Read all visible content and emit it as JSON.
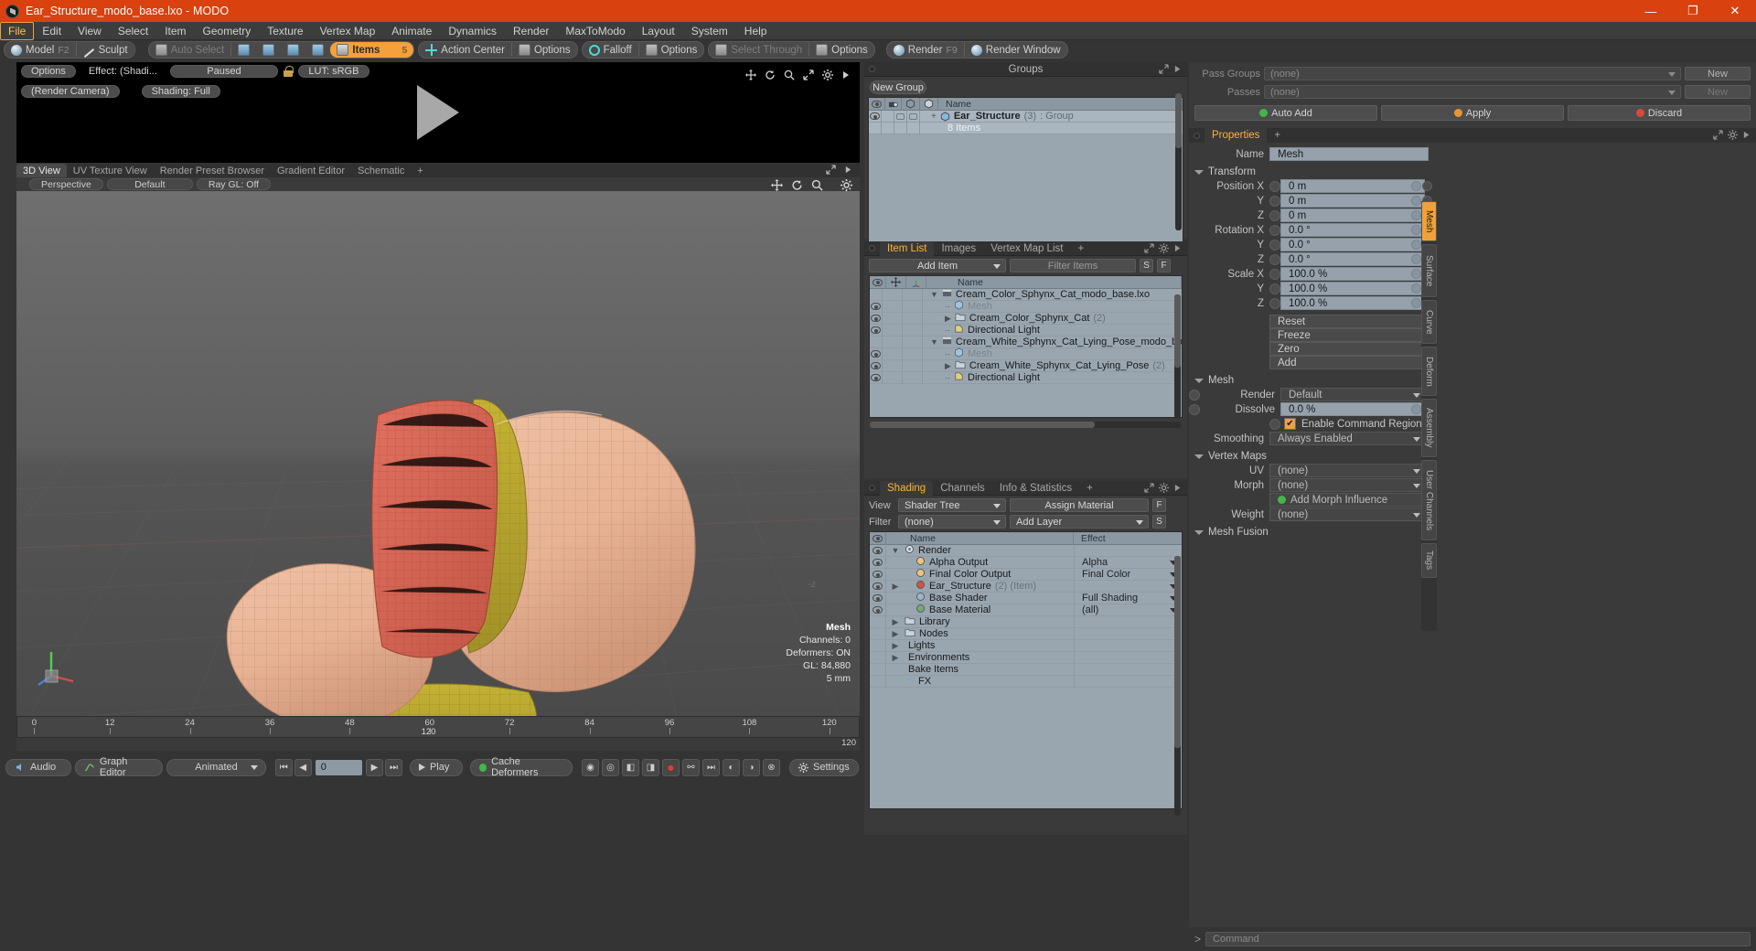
{
  "window": {
    "title": "Ear_Structure_modo_base.lxo - MODO",
    "minimize": "—",
    "maximize": "❐",
    "close": "✕"
  },
  "menubar": {
    "items": [
      "File",
      "Edit",
      "View",
      "Select",
      "Item",
      "Geometry",
      "Texture",
      "Vertex Map",
      "Animate",
      "Dynamics",
      "Render",
      "MaxToModo",
      "Layout",
      "System",
      "Help"
    ],
    "active": "File"
  },
  "toolbar": {
    "mode_group": [
      {
        "label": "Model",
        "shortcut": "F2"
      },
      {
        "label": "Sculpt",
        "shortcut": ""
      }
    ],
    "select_group": [
      {
        "label": "Auto Select",
        "shortcut": ""
      },
      {
        "label": "Items",
        "shortcut": "5",
        "active": true
      }
    ],
    "action_center": "Action Center",
    "options_1": "Options",
    "falloff": "Falloff",
    "options_2": "Options",
    "select_through": "Select Through",
    "options_3": "Options",
    "render": "Render",
    "render_key": "F9",
    "render_window": "Render Window"
  },
  "render_preview": {
    "options": "Options",
    "effect": "Effect: (Shadi...",
    "paused": "Paused",
    "lut": "LUT: sRGB",
    "camera": "(Render Camera)",
    "shading": "Shading: Full",
    "icons": [
      "move-icon",
      "refresh-icon",
      "zoom-icon",
      "fit-icon",
      "gear-icon",
      "play-arrow-icon"
    ]
  },
  "viewport": {
    "tabs": [
      "3D View",
      "UV Texture View",
      "Render Preset Browser",
      "Gradient Editor",
      "Schematic"
    ],
    "selected_tab": "3D View",
    "add_tab": "+",
    "sub_controls": [
      "Perspective",
      "Default",
      "Ray GL: Off"
    ],
    "icons": [
      "move-icon",
      "rotate-icon",
      "zoom-icon",
      "gear-icon"
    ],
    "stats": {
      "title": "Mesh",
      "channels_label": "Channels:",
      "channels_value": "0",
      "deformers_label": "Deformers:",
      "deformers_value": "ON",
      "gl_label": "GL:",
      "gl_value": "84,880",
      "scale": "5 mm"
    },
    "axis_label_z": "-z"
  },
  "timeline": {
    "ticks": [
      "0",
      "12",
      "24",
      "36",
      "48",
      "60",
      "72",
      "84",
      "96",
      "108",
      "120"
    ],
    "end_label": "120",
    "total_label": "120"
  },
  "bottombar": {
    "audio": "Audio",
    "graph_editor": "Graph Editor",
    "animated": "Animated",
    "frame_value": "0",
    "play": "Play",
    "cache_deformers": "Cache Deformers",
    "settings": "Settings"
  },
  "groups_panel": {
    "title": "Groups",
    "new_group_button": "New Group",
    "columns": [
      "Name"
    ],
    "rows": [
      {
        "name": "Ear_Structure",
        "count": "(3)",
        "type": ": Group",
        "sub": "8 Items",
        "selected": true
      }
    ]
  },
  "item_list": {
    "tabs": [
      "Item List",
      "Images",
      "Vertex Map List"
    ],
    "selected_tab": "Item List",
    "add_tab": "+",
    "add_item": "Add Item",
    "filter_placeholder": "Filter Items",
    "btn_s": "S",
    "btn_f": "F",
    "columns": [
      "Name"
    ],
    "rows": [
      {
        "name": "Cream_Color_Sphynx_Cat_modo_base.lxo",
        "indent": 0,
        "icon": "scene-icon",
        "bold": false
      },
      {
        "name": "Mesh",
        "indent": 1,
        "icon": "mesh-icon",
        "dim": true
      },
      {
        "name": "Cream_Color_Sphynx_Cat",
        "count": "(2)",
        "indent": 1,
        "icon": "folder-icon"
      },
      {
        "name": "Directional Light",
        "indent": 1,
        "icon": "light-icon"
      },
      {
        "name": "Cream_White_Sphynx_Cat_Lying_Pose_modo_base.lxo",
        "indent": 0,
        "icon": "scene-icon"
      },
      {
        "name": "Mesh",
        "indent": 1,
        "icon": "mesh-icon",
        "dim": true
      },
      {
        "name": "Cream_White_Sphynx_Cat_Lying_Pose",
        "count": "(2)",
        "indent": 1,
        "icon": "folder-icon"
      },
      {
        "name": "Directional Light",
        "indent": 1,
        "icon": "light-icon"
      }
    ]
  },
  "shading_panel": {
    "tabs": [
      "Shading",
      "Channels",
      "Info & Statistics"
    ],
    "selected_tab": "Shading",
    "add_tab": "+",
    "view_label": "View",
    "view_value": "Shader Tree",
    "assign_material": "Assign Material",
    "filter_label": "Filter",
    "filter_value": "(none)",
    "add_layer": "Add Layer",
    "btn_f": "F",
    "btn_s": "S",
    "columns": [
      "Name",
      "Effect"
    ],
    "rows": [
      {
        "name": "Render",
        "effect": "",
        "indent": 0,
        "icon": "render-icon"
      },
      {
        "name": "Alpha Output",
        "effect": "Alpha",
        "indent": 1,
        "icon": "output-icon"
      },
      {
        "name": "Final Color Output",
        "effect": "Final Color",
        "indent": 1,
        "icon": "output-icon"
      },
      {
        "name": "Ear_Structure",
        "count": "(2) (Item)",
        "effect": "",
        "indent": 1,
        "icon": "item-icon"
      },
      {
        "name": "Base Shader",
        "effect": "Full Shading",
        "indent": 1,
        "icon": "shader-icon"
      },
      {
        "name": "Base Material",
        "effect": "(all)",
        "indent": 1,
        "icon": "material-icon"
      },
      {
        "name": "Library",
        "effect": "",
        "indent": 0,
        "icon": "library-icon"
      },
      {
        "name": "Nodes",
        "effect": "",
        "indent": 0,
        "icon": "nodes-icon"
      },
      {
        "name": "Lights",
        "effect": "",
        "indent": 0,
        "icon": "lights-icon"
      },
      {
        "name": "Environments",
        "effect": "",
        "indent": 0,
        "icon": "env-icon"
      },
      {
        "name": "Bake Items",
        "effect": "",
        "indent": 0,
        "icon": "bake-icon"
      },
      {
        "name": "FX",
        "effect": "",
        "indent": 0,
        "icon": "fx-icon"
      }
    ]
  },
  "passes": {
    "pass_groups_label": "Pass Groups",
    "pass_groups_value": "(none)",
    "new_button": "New",
    "passes_label": "Passes",
    "passes_value": "(none)",
    "new_button2": "New",
    "auto_add": "Auto Add",
    "apply": "Apply",
    "discard": "Discard"
  },
  "properties": {
    "tab": "Properties",
    "add_tab": "+",
    "name_label": "Name",
    "name_value": "Mesh",
    "transform": {
      "title": "Transform",
      "fields": [
        {
          "label": "Position X",
          "value": "0 m"
        },
        {
          "label": "Y",
          "value": "0 m"
        },
        {
          "label": "Z",
          "value": "0 m"
        },
        {
          "label": "Rotation X",
          "value": "0.0 °"
        },
        {
          "label": "Y",
          "value": "0.0 °"
        },
        {
          "label": "Z",
          "value": "0.0 °"
        },
        {
          "label": "Scale X",
          "value": "100.0 %"
        },
        {
          "label": "Y",
          "value": "100.0 %"
        },
        {
          "label": "Z",
          "value": "100.0 %"
        }
      ],
      "menus": [
        "Reset",
        "Freeze",
        "Zero",
        "Add"
      ]
    },
    "mesh": {
      "title": "Mesh",
      "render_label": "Render",
      "render_value": "Default",
      "dissolve_label": "Dissolve",
      "dissolve_value": "0.0 %",
      "enable_command_regions": "Enable Command Regions",
      "enable_checked": true,
      "smoothing_label": "Smoothing",
      "smoothing_value": "Always Enabled"
    },
    "vertex_maps": {
      "title": "Vertex Maps",
      "uv_label": "UV",
      "uv_value": "(none)",
      "morph_label": "Morph",
      "morph_value": "(none)",
      "add_morph_influence": "Add Morph Influence",
      "weight_label": "Weight",
      "weight_value": "(none)"
    },
    "mesh_fusion": {
      "title": "Mesh Fusion"
    }
  },
  "side_tabs": {
    "items": [
      "Mesh",
      "Surface",
      "Curve",
      "Deform",
      "Assembly",
      "User Channels",
      "Tags"
    ],
    "selected": "Mesh"
  },
  "command_bar": {
    "prompt": ">",
    "placeholder": "Command"
  },
  "colors": {
    "accent_orange": "#f0a13a",
    "titlebar_red": "#d9410f",
    "panel_bg": "#3a3a3a",
    "list_bg": "#9aa6af"
  }
}
